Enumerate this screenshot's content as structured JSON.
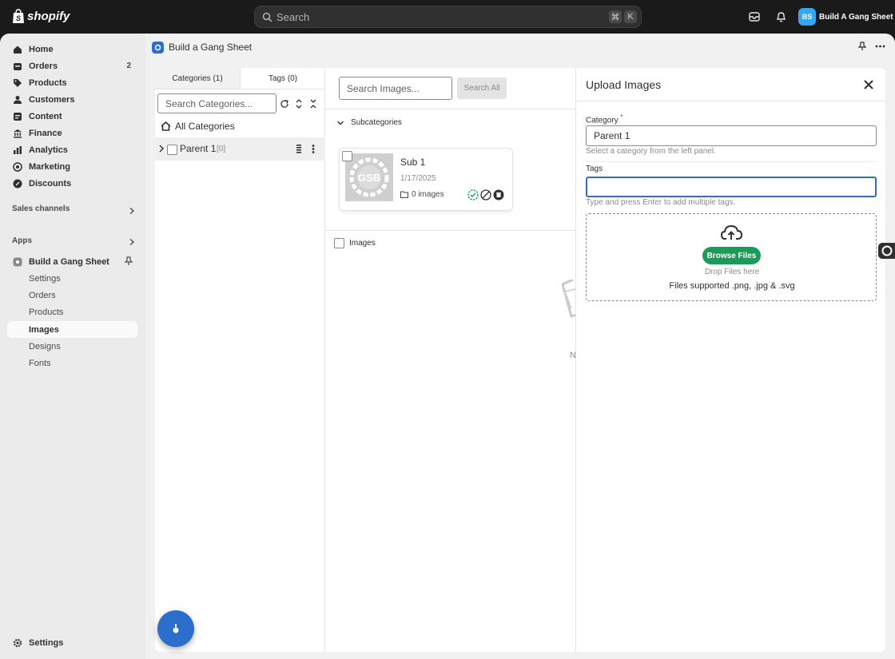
{
  "topbar": {
    "brand": "shopify",
    "search_placeholder": "Search",
    "shortcut_cmd": "⌘",
    "shortcut_key": "K",
    "store_initials": "BS",
    "store_name": "Build A Gang Sheet"
  },
  "sidebar": {
    "items": [
      {
        "label": "Home",
        "icon": "home-icon"
      },
      {
        "label": "Orders",
        "icon": "orders-icon",
        "count": "2"
      },
      {
        "label": "Products",
        "icon": "tag-icon"
      },
      {
        "label": "Customers",
        "icon": "person-icon"
      },
      {
        "label": "Content",
        "icon": "content-icon"
      },
      {
        "label": "Finance",
        "icon": "bank-icon"
      },
      {
        "label": "Analytics",
        "icon": "chart-icon"
      },
      {
        "label": "Marketing",
        "icon": "target-icon"
      },
      {
        "label": "Discounts",
        "icon": "discount-icon"
      }
    ],
    "sales_channels": "Sales channels",
    "apps": "Apps",
    "app_name": "Build a Gang Sheet",
    "app_sub": [
      "Settings",
      "Orders",
      "Products",
      "Images",
      "Designs",
      "Fonts"
    ],
    "settings": "Settings"
  },
  "app_header": {
    "title": "Build a Gang Sheet"
  },
  "categories": {
    "tab_categories": "Categories (1)",
    "tab_tags": "Tags (0)",
    "search_placeholder": "Search Categories...",
    "all_label": "All Categories",
    "tree": [
      {
        "label": "Parent 1",
        "count": "[0]"
      }
    ]
  },
  "images": {
    "search_placeholder": "Search Images...",
    "search_all": "Search All",
    "subcategories": "Subcategories",
    "card": {
      "title": "Sub 1",
      "date": "1/17/2025",
      "count": "0 images"
    },
    "images_label": "Images",
    "empty_text": "N"
  },
  "upload": {
    "title": "Upload Images",
    "category_label": "Category",
    "required_mark": "*",
    "category_value": "Parent 1",
    "category_hint": "Select a category from the left panel.",
    "tags_label": "Tags",
    "tags_value": "",
    "tags_hint": "Type and press Enter to add multiple tags.",
    "browse": "Browse Files",
    "drop_text": "Drop Files here",
    "supported": "Files supported .png, .jpg & .svg"
  },
  "colors": {
    "accent": "#2c6ecb",
    "browse_green": "#1a9b5a",
    "store_avatar": "#35a6f4"
  }
}
